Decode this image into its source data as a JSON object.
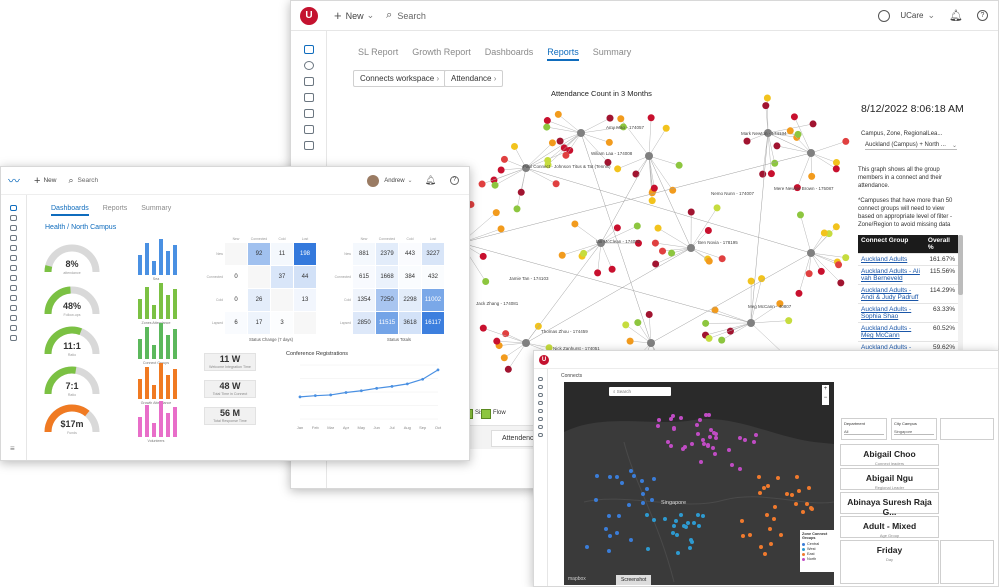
{
  "back": {
    "app_title": "UCare",
    "new_label": "New",
    "search_placeholder": "Search",
    "tabs": [
      {
        "label": "SL Report"
      },
      {
        "label": "Growth Report"
      },
      {
        "label": "Dashboards"
      },
      {
        "label": "Reports",
        "active": true
      },
      {
        "label": "Summary"
      }
    ],
    "breadcrumbs": [
      "Connects workspace",
      "Attendance"
    ],
    "chart_title": "Attendance Count in 3 Months",
    "datetime": "8/12/2022 8:06:18 AM",
    "filter_label": "Campus, Zone, RegionalLea...",
    "filter_value": "Auckland (Campus) + North ...",
    "desc1": "This graph shows all the group members in a connect and their attendance.",
    "desc2": "*Campuses that have more than 50 connect groups will need to view based on appropriate level of filter - Zone/Region to avoid missing data",
    "table": {
      "headers": [
        "Connect Group",
        "Overall %"
      ],
      "rows": [
        [
          "Auckland Adults",
          "161.67%"
        ],
        [
          "Auckland Adults - Ali vah Berneveld",
          "115.56%"
        ],
        [
          "Auckland Adults - Andi & Judy Padruff",
          "114.29%"
        ],
        [
          "Auckland Adults - Sophia Shao",
          "63.33%"
        ],
        [
          "Auckland Adults - Meg McCann",
          "60.52%"
        ],
        [
          "Auckland Adults - Murray & Colleen Cole",
          "59.62%"
        ]
      ]
    },
    "legend": [
      "Sis",
      "Flow"
    ],
    "bottom_tab": "Attendence",
    "nodes": [
      {
        "label": "Paul Connect - Johnson Titus & Tat (Tennis)"
      },
      {
        "label": "Amy Mao - 174057"
      },
      {
        "label": "Ian McClean - 174092"
      },
      {
        "label": "Ben Novia - 178195"
      },
      {
        "label": "Nemo Nunn - 174007"
      },
      {
        "label": "Meg McCann - 40807"
      },
      {
        "label": "Mere Newbie Brown - 175087"
      },
      {
        "label": "Thomas Zhou - 174459"
      },
      {
        "label": "Nick Zanhurst - 174051"
      },
      {
        "label": "Jack Zhang - 174081"
      },
      {
        "label": "Wiliam Laa - 174008"
      },
      {
        "label": "Jamie Tan - 174103"
      },
      {
        "label": "Mark Newton - 174134"
      }
    ]
  },
  "left": {
    "user": "Andrew",
    "new_label": "New",
    "search_placeholder": "Search",
    "tabs": [
      {
        "label": "Dashboards",
        "active": true
      },
      {
        "label": "Reports"
      },
      {
        "label": "Summary"
      }
    ],
    "location": "Health / North Campus",
    "gauges": [
      {
        "value": "8%",
        "caption": "attendance",
        "pct": 0.08,
        "color": "#7bc143"
      },
      {
        "value": "48%",
        "caption": "Follow-ups",
        "pct": 0.48,
        "color": "#7bc143"
      },
      {
        "value": "11:1",
        "caption": "Ratio",
        "pct": 0.62,
        "color": "#7bc143"
      },
      {
        "value": "7:1",
        "caption": "Ratio",
        "pct": 0.55,
        "color": "#7bc143"
      },
      {
        "value": "$17m",
        "caption": "Funds",
        "pct": 0.72,
        "color": "#f07a22"
      }
    ],
    "bar_groups": [
      {
        "caption": "Sea",
        "color": "#4a90e2"
      },
      {
        "caption": "Zones Attendance",
        "color": "#7bc143"
      },
      {
        "caption": "Connect Groups",
        "color": "#5cb85c"
      },
      {
        "caption": "Growth Attendance",
        "color": "#f07a22"
      },
      {
        "caption": "Volunteers",
        "color": "#e86ec9"
      }
    ],
    "heat1": {
      "caption": "Status Change (7 days)",
      "cols": [
        "New",
        "Connected",
        "Cold",
        "Lost"
      ],
      "rows": [
        "New",
        "Connected",
        "Cold",
        "Lapsed"
      ],
      "values": [
        [
          "",
          "92",
          "11",
          "198"
        ],
        [
          "0",
          "",
          "37",
          "44"
        ],
        [
          "0",
          "26",
          "",
          "13"
        ],
        [
          "6",
          "17",
          "3",
          ""
        ]
      ]
    },
    "heat2": {
      "caption": "Status Totals",
      "cols": [
        "New",
        "Connected",
        "Cold",
        "Lost"
      ],
      "rows": [
        "New",
        "Connected",
        "Cold",
        "Lapsed"
      ],
      "values": [
        [
          "881",
          "2379",
          "443",
          "3227"
        ],
        [
          "615",
          "1668",
          "384",
          "432"
        ],
        [
          "1354",
          "7250",
          "2298",
          "11002"
        ],
        [
          "2850",
          "11515",
          "3618",
          "16117"
        ]
      ]
    },
    "kpis": [
      {
        "value": "11 W",
        "caption": "Welcome Integration Time"
      },
      {
        "value": "48 W",
        "caption": "Total Time in Connect"
      },
      {
        "value": "56 M",
        "caption": "Total Response Time"
      }
    ],
    "line_chart": {
      "title": "Conference Registrations",
      "x": [
        "Jan",
        "Feb",
        "Mar",
        "Apr",
        "May",
        "Jun",
        "Jul",
        "Aug",
        "Sep",
        "Oct"
      ],
      "values": [
        90,
        95,
        98,
        108,
        115,
        125,
        133,
        143,
        162,
        200
      ]
    }
  },
  "map": {
    "app_title": "Connects",
    "search_placeholder": "Search",
    "map_label": "Singapore",
    "legend_title": "Zone Connect Groups",
    "legend_items": [
      {
        "label": "Central",
        "color": "#3b7dd8"
      },
      {
        "label": "West",
        "color": "#2e9ad0"
      },
      {
        "label": "East",
        "color": "#f07a2e"
      },
      {
        "label": "North",
        "color": "#c04cc4"
      }
    ],
    "footer_logo": "mapbox",
    "screenshot_label": "Screenshot",
    "filters": [
      {
        "label": "Department",
        "value": "All"
      },
      {
        "label": "City Campus",
        "value": "Singapore"
      }
    ],
    "cards": [
      {
        "title": "Abigail Choo",
        "caption": "Connect leaders"
      },
      {
        "title": "Abigail Ngu",
        "caption": "Regional Leader"
      },
      {
        "title": "Abinaya Suresh Raja G...",
        "caption": "Assistant Connect Leader"
      },
      {
        "title": "Adult - Mixed",
        "caption": "Age Group"
      },
      {
        "title": "Friday",
        "caption": "Day"
      }
    ]
  },
  "colors": {
    "accent": "#0f6cbd",
    "brand": "#c4122f",
    "map_bg": "#2a2a2a"
  }
}
